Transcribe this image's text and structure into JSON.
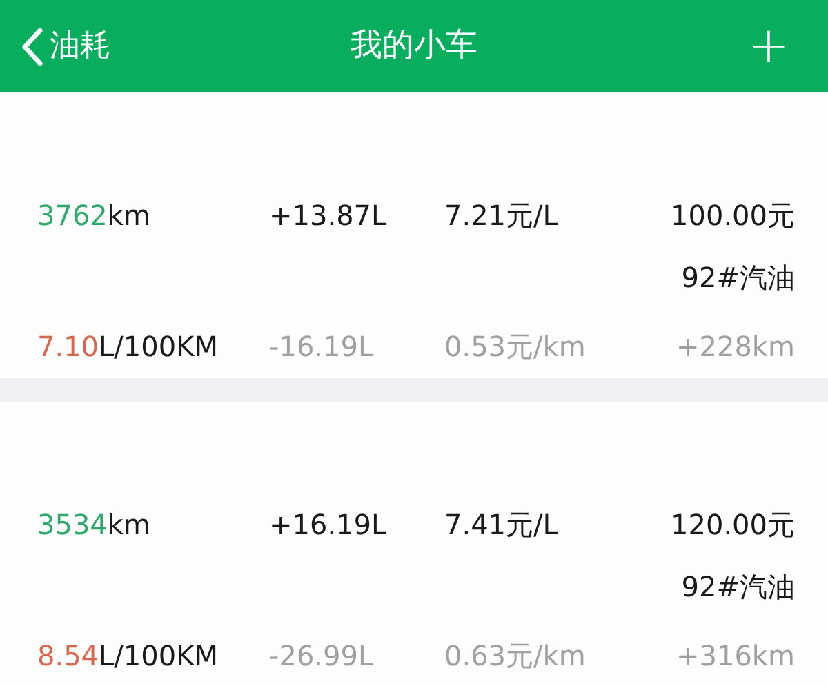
{
  "nav_bar": {
    "back_label": "油耗",
    "title": "我的小车",
    "add_symbol": "+"
  },
  "records": [
    {
      "odometer_value": "3762",
      "odometer_unit": "km",
      "fuel_added": "+13.87L",
      "unit_price": "7.21元/L",
      "amount": "100.00元",
      "fuel_type": "92#汽油",
      "consumption_value": "7.10",
      "consumption_unit": "L/100KM",
      "fuel_diff": "-16.19L",
      "cost_per_km": "0.53元/km",
      "distance": "+228km"
    },
    {
      "odometer_value": "3534",
      "odometer_unit": "km",
      "fuel_added": "+16.19L",
      "unit_price": "7.41元/L",
      "amount": "120.00元",
      "fuel_type": "92#汽油",
      "consumption_value": "8.54",
      "consumption_unit": "L/100KM",
      "fuel_diff": "-26.99L",
      "cost_per_km": "0.63元/km",
      "distance": "+316km"
    }
  ]
}
